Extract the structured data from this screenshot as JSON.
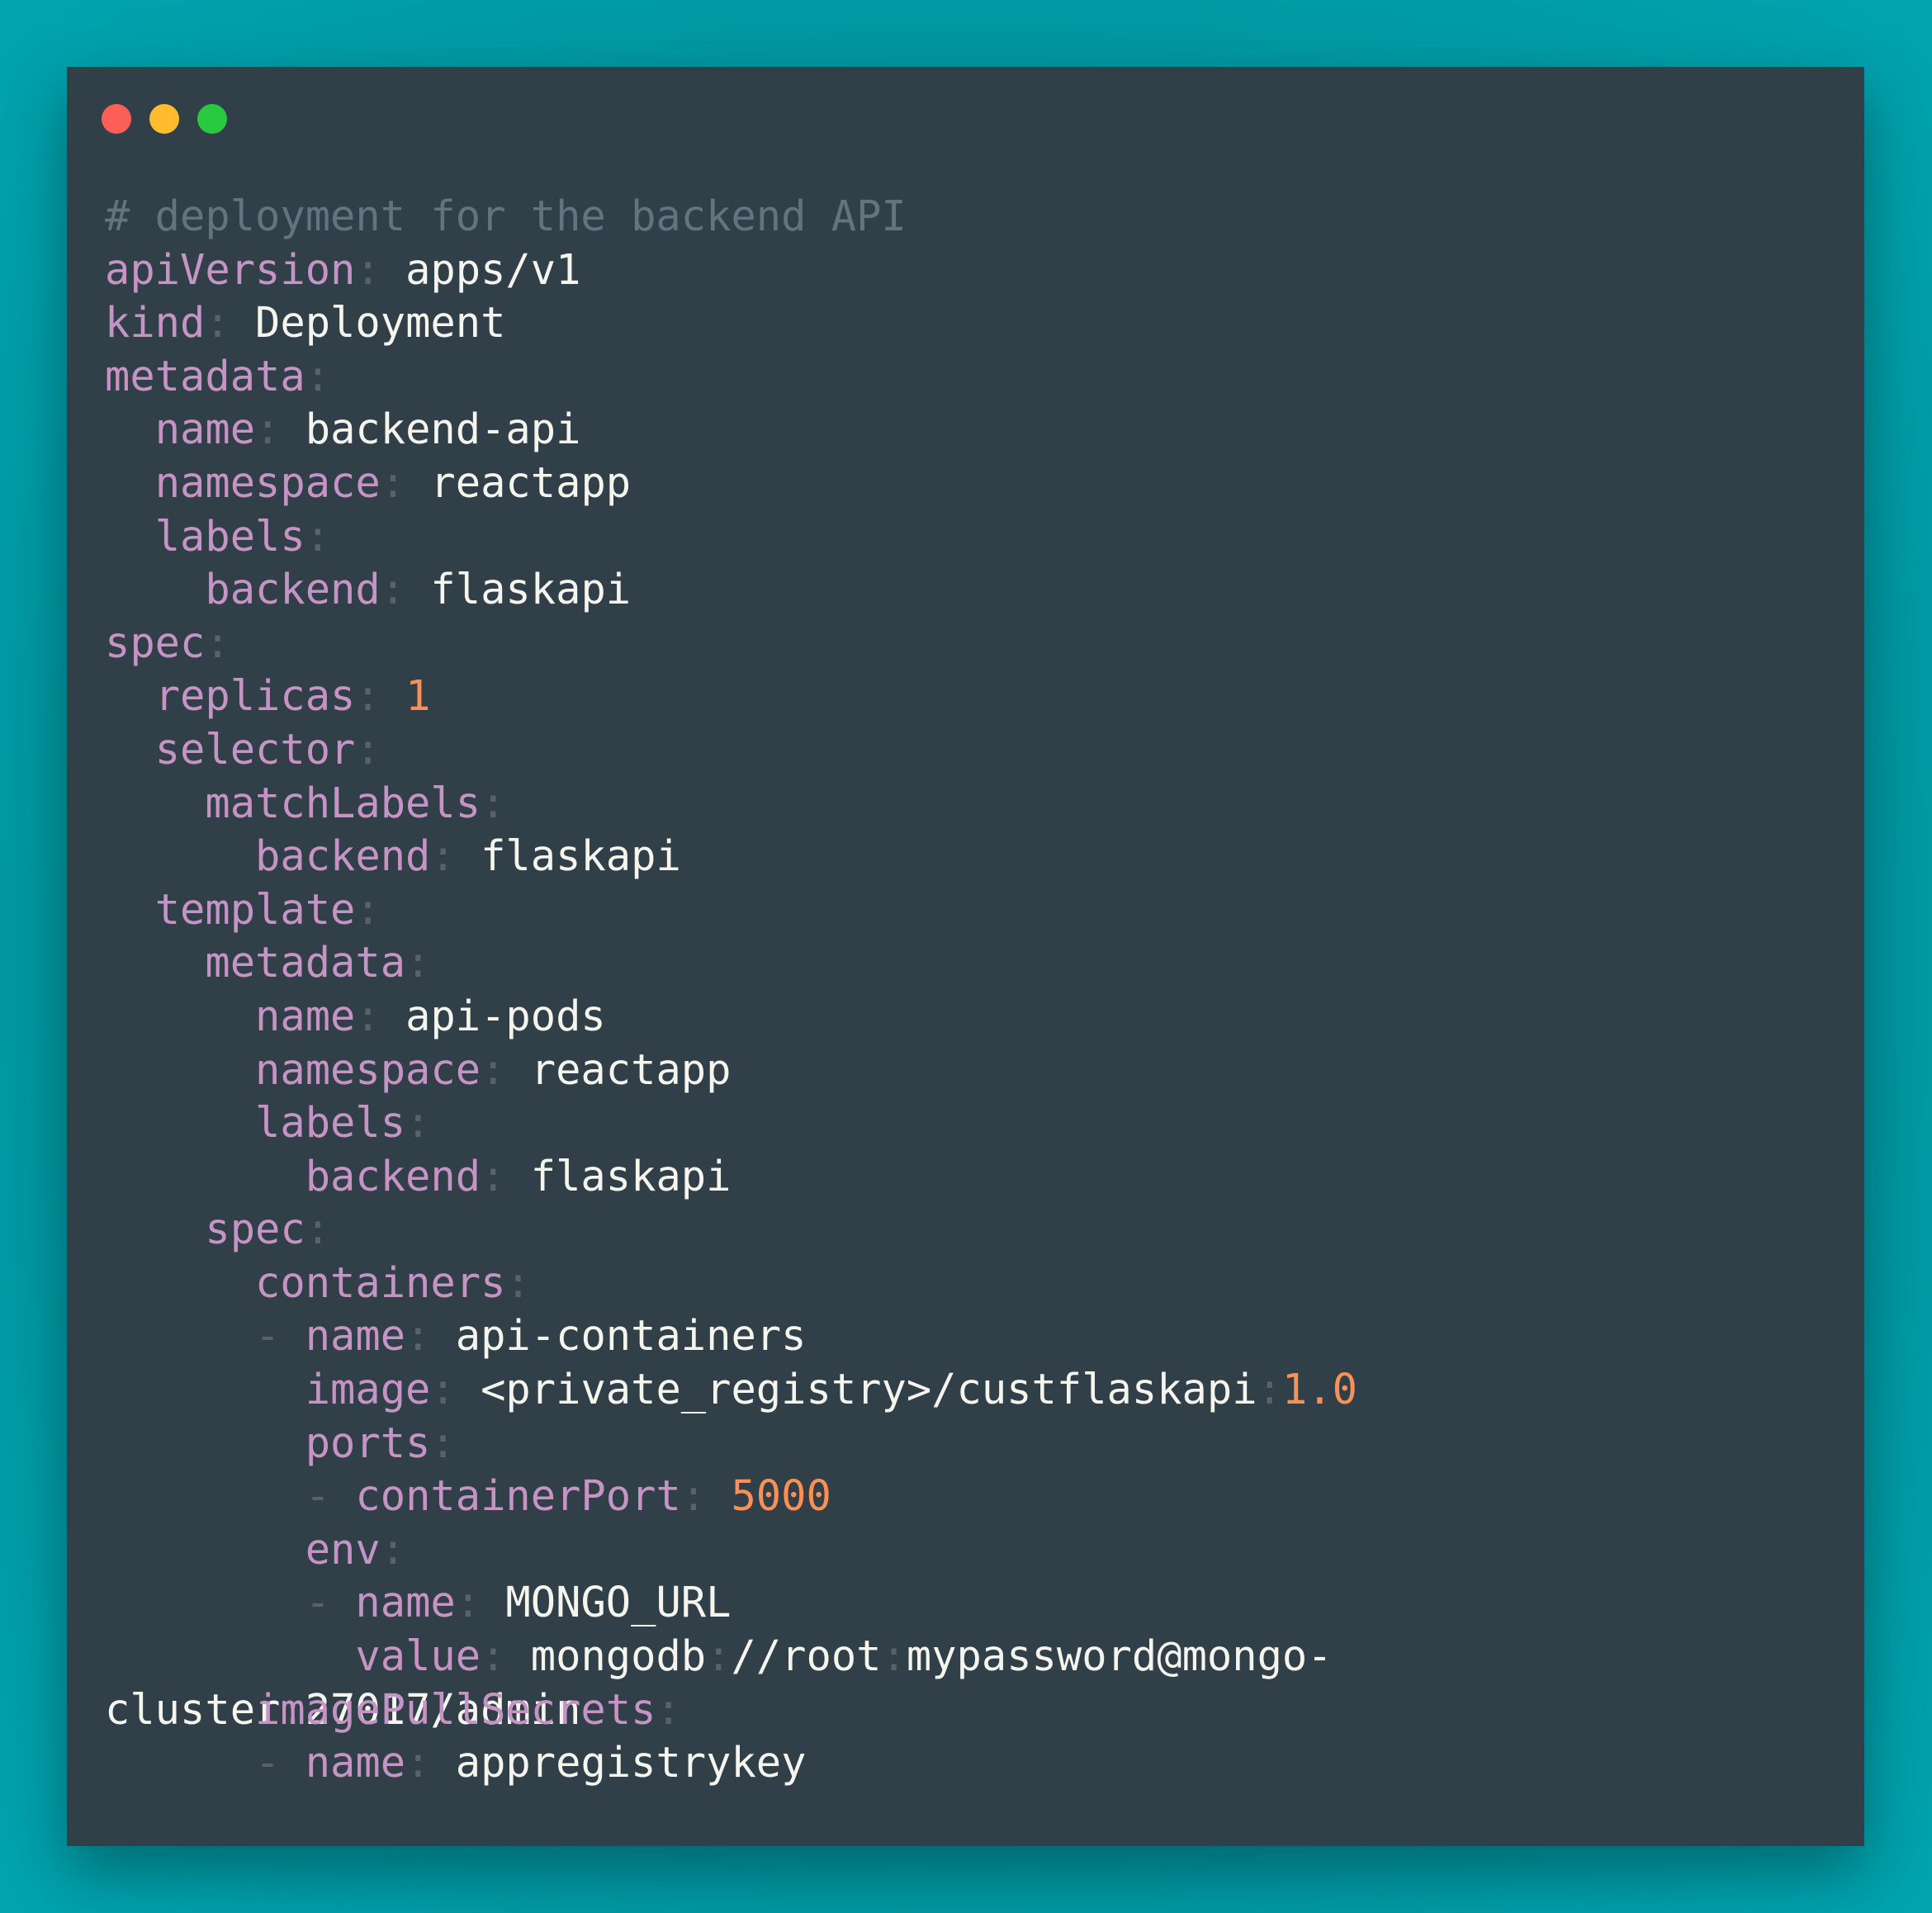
{
  "window": {
    "controls": [
      "close",
      "minimize",
      "maximize"
    ],
    "colors": {
      "close": "#ff5f56",
      "minimize": "#ffbd2e",
      "maximize": "#27c93f"
    }
  },
  "theme": {
    "key": "#c594c5",
    "value": "#f5f5ee",
    "number": "#f99157",
    "comment": "#65737e",
    "punctuation": "#5c6166",
    "background": "#303f48"
  },
  "code": {
    "language": "yaml",
    "lines": [
      [
        {
          "t": "c",
          "s": "# deployment for the backend API"
        }
      ],
      [
        {
          "t": "k",
          "s": "apiVersion"
        },
        {
          "t": "p",
          "s": ":"
        },
        {
          "t": "v",
          "s": " apps/v1"
        }
      ],
      [
        {
          "t": "k",
          "s": "kind"
        },
        {
          "t": "p",
          "s": ":"
        },
        {
          "t": "v",
          "s": " Deployment"
        }
      ],
      [
        {
          "t": "k",
          "s": "metadata"
        },
        {
          "t": "p",
          "s": ":"
        }
      ],
      [
        {
          "t": "v",
          "s": "  "
        },
        {
          "t": "k",
          "s": "name"
        },
        {
          "t": "p",
          "s": ":"
        },
        {
          "t": "v",
          "s": " backend-api"
        }
      ],
      [
        {
          "t": "v",
          "s": "  "
        },
        {
          "t": "k",
          "s": "namespace"
        },
        {
          "t": "p",
          "s": ":"
        },
        {
          "t": "v",
          "s": " reactapp"
        }
      ],
      [
        {
          "t": "v",
          "s": "  "
        },
        {
          "t": "k",
          "s": "labels"
        },
        {
          "t": "p",
          "s": ":"
        }
      ],
      [
        {
          "t": "v",
          "s": "    "
        },
        {
          "t": "k",
          "s": "backend"
        },
        {
          "t": "p",
          "s": ":"
        },
        {
          "t": "v",
          "s": " flaskapi"
        }
      ],
      [
        {
          "t": "k",
          "s": "spec"
        },
        {
          "t": "p",
          "s": ":"
        }
      ],
      [
        {
          "t": "v",
          "s": "  "
        },
        {
          "t": "k",
          "s": "replicas"
        },
        {
          "t": "p",
          "s": ":"
        },
        {
          "t": "v",
          "s": " "
        },
        {
          "t": "n",
          "s": "1"
        }
      ],
      [
        {
          "t": "v",
          "s": "  "
        },
        {
          "t": "k",
          "s": "selector"
        },
        {
          "t": "p",
          "s": ":"
        }
      ],
      [
        {
          "t": "v",
          "s": "    "
        },
        {
          "t": "k",
          "s": "matchLabels"
        },
        {
          "t": "p",
          "s": ":"
        }
      ],
      [
        {
          "t": "v",
          "s": "      "
        },
        {
          "t": "k",
          "s": "backend"
        },
        {
          "t": "p",
          "s": ":"
        },
        {
          "t": "v",
          "s": " flaskapi"
        }
      ],
      [
        {
          "t": "v",
          "s": "  "
        },
        {
          "t": "k",
          "s": "template"
        },
        {
          "t": "p",
          "s": ":"
        }
      ],
      [
        {
          "t": "v",
          "s": "    "
        },
        {
          "t": "k",
          "s": "metadata"
        },
        {
          "t": "p",
          "s": ":"
        }
      ],
      [
        {
          "t": "v",
          "s": "      "
        },
        {
          "t": "k",
          "s": "name"
        },
        {
          "t": "p",
          "s": ":"
        },
        {
          "t": "v",
          "s": " api-pods"
        }
      ],
      [
        {
          "t": "v",
          "s": "      "
        },
        {
          "t": "k",
          "s": "namespace"
        },
        {
          "t": "p",
          "s": ":"
        },
        {
          "t": "v",
          "s": " reactapp"
        }
      ],
      [
        {
          "t": "v",
          "s": "      "
        },
        {
          "t": "k",
          "s": "labels"
        },
        {
          "t": "p",
          "s": ":"
        }
      ],
      [
        {
          "t": "v",
          "s": "        "
        },
        {
          "t": "k",
          "s": "backend"
        },
        {
          "t": "p",
          "s": ":"
        },
        {
          "t": "v",
          "s": " flaskapi"
        }
      ],
      [
        {
          "t": "v",
          "s": "    "
        },
        {
          "t": "k",
          "s": "spec"
        },
        {
          "t": "p",
          "s": ":"
        }
      ],
      [
        {
          "t": "v",
          "s": "      "
        },
        {
          "t": "k",
          "s": "containers"
        },
        {
          "t": "p",
          "s": ":"
        }
      ],
      [
        {
          "t": "v",
          "s": "      "
        },
        {
          "t": "p",
          "s": "-"
        },
        {
          "t": "v",
          "s": " "
        },
        {
          "t": "k",
          "s": "name"
        },
        {
          "t": "p",
          "s": ":"
        },
        {
          "t": "v",
          "s": " api-containers"
        }
      ],
      [
        {
          "t": "v",
          "s": "        "
        },
        {
          "t": "k",
          "s": "image"
        },
        {
          "t": "p",
          "s": ":"
        },
        {
          "t": "v",
          "s": " <private_registry>/custflaskapi"
        },
        {
          "t": "p",
          "s": ":"
        },
        {
          "t": "n",
          "s": "1.0"
        }
      ],
      [
        {
          "t": "v",
          "s": "        "
        },
        {
          "t": "k",
          "s": "ports"
        },
        {
          "t": "p",
          "s": ":"
        }
      ],
      [
        {
          "t": "v",
          "s": "        "
        },
        {
          "t": "p",
          "s": "-"
        },
        {
          "t": "v",
          "s": " "
        },
        {
          "t": "k",
          "s": "containerPort"
        },
        {
          "t": "p",
          "s": ":"
        },
        {
          "t": "v",
          "s": " "
        },
        {
          "t": "n",
          "s": "5000"
        }
      ],
      [
        {
          "t": "v",
          "s": "        "
        },
        {
          "t": "k",
          "s": "env"
        },
        {
          "t": "p",
          "s": ":"
        }
      ],
      [
        {
          "t": "v",
          "s": "        "
        },
        {
          "t": "p",
          "s": "-"
        },
        {
          "t": "v",
          "s": " "
        },
        {
          "t": "k",
          "s": "name"
        },
        {
          "t": "p",
          "s": ":"
        },
        {
          "t": "v",
          "s": " MONGO_URL"
        }
      ],
      [
        {
          "t": "v",
          "s": "          "
        },
        {
          "t": "k",
          "s": "value"
        },
        {
          "t": "p",
          "s": ":"
        },
        {
          "t": "v",
          "s": " mongodb"
        },
        {
          "t": "p",
          "s": ":"
        },
        {
          "t": "v",
          "s": "//root"
        },
        {
          "t": "p",
          "s": ":"
        },
        {
          "t": "v",
          "s": "mypassword@mongo-"
        }
      ],
      {
        "base": [
          {
            "t": "v",
            "s": "cluster"
          },
          {
            "t": "p",
            "s": ":"
          },
          {
            "t": "v",
            "s": "27017/admin"
          }
        ],
        "overlay": [
          {
            "t": "v",
            "s": "      "
          },
          {
            "t": "k",
            "s": "imagePullSecrets"
          },
          {
            "t": "p",
            "s": ":"
          }
        ]
      },
      [
        {
          "t": "v",
          "s": "      "
        },
        {
          "t": "p",
          "s": "-"
        },
        {
          "t": "v",
          "s": " "
        },
        {
          "t": "k",
          "s": "name"
        },
        {
          "t": "p",
          "s": ":"
        },
        {
          "t": "v",
          "s": " appregistrykey"
        }
      ]
    ]
  }
}
